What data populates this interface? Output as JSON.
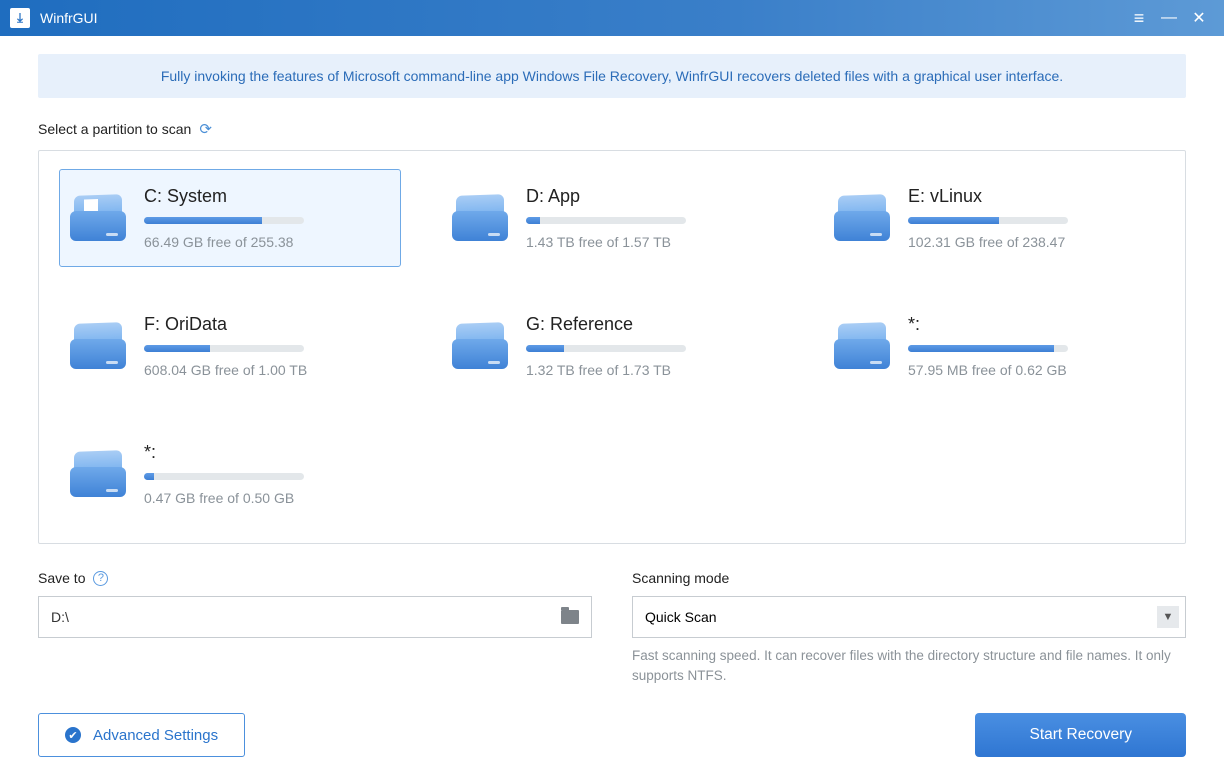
{
  "app": {
    "title": "WinfrGUI"
  },
  "banner": "Fully invoking the features of Microsoft command-line app Windows File Recovery, WinfrGUI recovers deleted files with a graphical user interface.",
  "select_label": "Select a partition to scan",
  "partitions": [
    {
      "name": "C: System",
      "free": "66.49 GB free of 255.38",
      "used_pct": 74,
      "selected": true,
      "win": true
    },
    {
      "name": "D: App",
      "free": "1.43 TB free of 1.57 TB",
      "used_pct": 9,
      "selected": false,
      "win": false
    },
    {
      "name": "E: vLinux",
      "free": "102.31 GB free of 238.47",
      "used_pct": 57,
      "selected": false,
      "win": false
    },
    {
      "name": "F: OriData",
      "free": "608.04 GB free of 1.00 TB",
      "used_pct": 41,
      "selected": false,
      "win": false
    },
    {
      "name": "G: Reference",
      "free": "1.32 TB free of 1.73 TB",
      "used_pct": 24,
      "selected": false,
      "win": false
    },
    {
      "name": "*:",
      "free": "57.95 MB free of 0.62 GB",
      "used_pct": 91,
      "selected": false,
      "win": false
    },
    {
      "name": "*:",
      "free": "0.47 GB free of 0.50 GB",
      "used_pct": 6,
      "selected": false,
      "win": false
    }
  ],
  "save_to": {
    "label": "Save to",
    "value": "D:\\"
  },
  "scan_mode": {
    "label": "Scanning mode",
    "value": "Quick Scan",
    "description": "Fast scanning speed. It can recover files with the directory structure and file names. It only supports NTFS."
  },
  "buttons": {
    "advanced": "Advanced Settings",
    "start": "Start Recovery"
  }
}
